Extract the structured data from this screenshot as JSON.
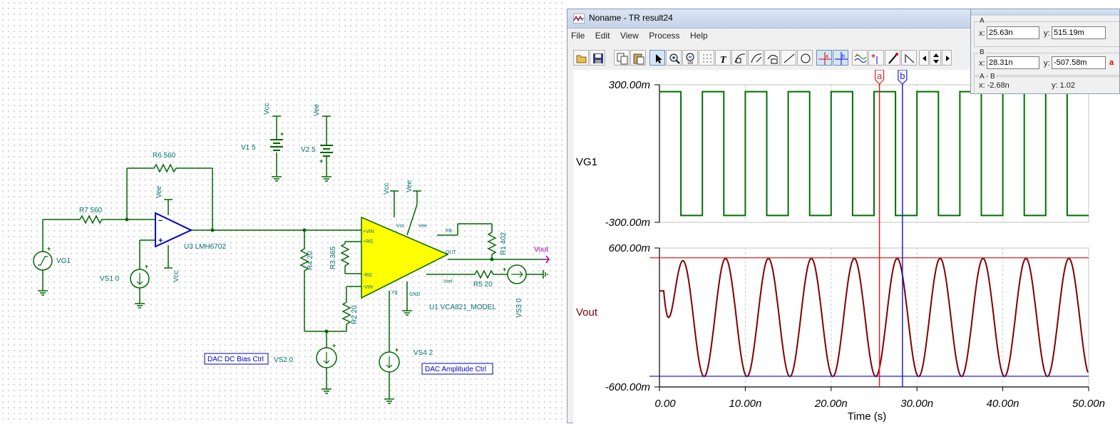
{
  "schematic": {
    "components": {
      "r6": "R6 560",
      "r7": "R7 560",
      "v1": "V1 5",
      "v2": "V2 5",
      "vg1": "VG1",
      "vs1": "VS1 0",
      "u3": "U3 LMH6702",
      "r4": "R4 20",
      "r3": "R3 365",
      "r2": "R2 20",
      "r1": "R1 402",
      "r5": "R5 20",
      "u1": "U1 VCA821_MODEL",
      "vs3": "VS3 0",
      "vs2": "VS2 0",
      "vs4": "VS4 2",
      "vout": "Vout"
    },
    "rail_labels": {
      "vcc": "Vcc",
      "vee": "Vee"
    },
    "pins": {
      "pvin": "+VIN",
      "prg": "+RG",
      "mrg": "-RG",
      "mvin": "-VIN",
      "vcc": "Vcc",
      "vee": "Vee",
      "fb": "FB",
      "out": "OUT",
      "vref": "Vref",
      "vg": "Vg",
      "gnd": "GND"
    },
    "boxes": {
      "dac_bias": "DAC DC Bias Ctrl",
      "dac_amp": "DAC Amplitude Ctrl"
    },
    "colors": {
      "wire": "#006600",
      "label": "#007070",
      "opamp": "#0000c0",
      "vca_fill": "#ffff00",
      "vout": "#a000a0"
    }
  },
  "window": {
    "title": "Noname - TR result24",
    "menu": [
      "File",
      "Edit",
      "View",
      "Process",
      "Help"
    ]
  },
  "toolbar": {
    "icons": [
      "open-icon",
      "save-icon",
      "copy-icon",
      "paste-icon",
      "pointer-icon",
      "zoom-in-icon",
      "zoom-100-icon",
      "grid-icon",
      "text-icon",
      "curve-label-icon",
      "curve-label-2-icon",
      "curve-label-3-icon",
      "line-icon",
      "circle-icon",
      "cursor-a-icon",
      "cursor-b-icon",
      "waveform-icon",
      "marker-icon",
      "pen-icon",
      "slope-icon",
      "arrow-left-icon",
      "arrow-updown-icon",
      "arrow-right-icon"
    ]
  },
  "cursors": {
    "a_label": "a",
    "b_label": "b",
    "panel": {
      "a_group": "A",
      "b_group": "B",
      "ab_group": "A - B",
      "x_label": "x:",
      "y_label": "y:",
      "a_x": "25.63n",
      "a_y": "515.19m",
      "b_x": "28.31n",
      "b_y": "-507.58m",
      "ab_x": "x: -2.68n",
      "ab_y": "y: 1.02",
      "a_marker": "a"
    },
    "color_a": "#e02020",
    "color_b": "#2020e0"
  },
  "chart_data": [
    {
      "type": "line",
      "series": [
        {
          "name": "VG1",
          "color": "#007000",
          "period_ns": 5,
          "duty": 0.5,
          "high": 0.27,
          "low": -0.27
        }
      ],
      "x": [
        0,
        50
      ],
      "ylabel": "VG1",
      "y_ticks": [
        "300.00m",
        "-300.00m"
      ],
      "ylim": [
        -0.3,
        0.3
      ],
      "xlim": [
        0,
        50
      ],
      "grid": true
    },
    {
      "type": "line",
      "series": [
        {
          "name": "Vout",
          "color": "#800000",
          "period_ns": 5,
          "amplitude": 0.51,
          "start_ns": 0.5
        }
      ],
      "x": [
        0,
        50
      ],
      "ylabel": "Vout",
      "y_ticks": [
        "600.00m",
        "-600.00m"
      ],
      "ylim": [
        -0.6,
        0.6
      ],
      "xlim": [
        0,
        50
      ],
      "x_ticks": [
        "0.00",
        "10.00n",
        "20.00n",
        "30.00n",
        "40.00n",
        "50.00n"
      ],
      "xlabel": "Time (s)",
      "cursor_a": {
        "x": 25.63,
        "y": 0.51519
      },
      "cursor_b": {
        "x": 28.31,
        "y": -0.50758
      },
      "grid": true
    }
  ]
}
